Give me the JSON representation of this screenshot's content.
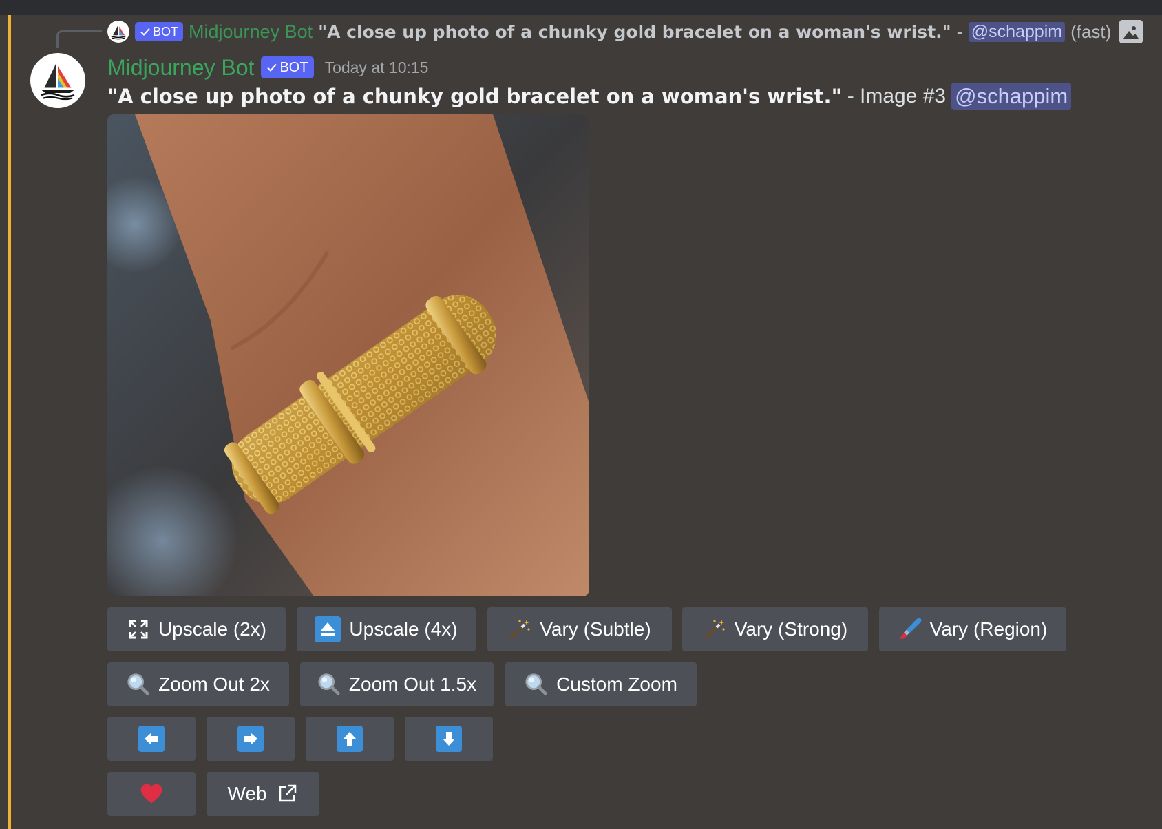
{
  "reply": {
    "bot_tag": "BOT",
    "author": "Midjourney Bot",
    "prompt": "\"A close up photo of a chunky gold bracelet on a woman's wrist.\"",
    "separator": "-",
    "mention": "@schappim",
    "mode": "(fast)"
  },
  "message": {
    "author": "Midjourney Bot",
    "bot_tag": "BOT",
    "timestamp": "Today at 10:15",
    "prompt": "\"A close up photo of a chunky gold bracelet on a woman's wrist.\"",
    "image_label": "- Image #3",
    "mention": "@schappim"
  },
  "buttons": {
    "upscale_2x": "Upscale (2x)",
    "upscale_4x": "Upscale (4x)",
    "vary_subtle": "Vary (Subtle)",
    "vary_strong": "Vary (Strong)",
    "vary_region": "Vary (Region)",
    "zoom_out_2x": "Zoom Out 2x",
    "zoom_out_1_5x": "Zoom Out 1.5x",
    "custom_zoom": "Custom Zoom",
    "web": "Web"
  },
  "icons": {
    "upscale_2x": "expand-icon",
    "upscale_4x": "up-arrow-box-icon",
    "vary_subtle": "magic-wand-icon",
    "vary_strong": "magic-wand-icon",
    "vary_region": "paintbrush-icon",
    "zoom": "magnifier-icon",
    "pan_left": "arrow-left-icon",
    "pan_right": "arrow-right-icon",
    "pan_up": "arrow-up-icon",
    "pan_down": "arrow-down-icon",
    "favorite": "heart-icon",
    "web": "external-link-icon"
  },
  "colors": {
    "background": "#3f3c3a",
    "highlight_bar": "#f0b232",
    "author": "#3ba55c",
    "bot_tag": "#5865f2",
    "mention_bg": "#4e5387",
    "button": "#4e5058",
    "arrow_blue": "#3c8fd7",
    "heart": "#dd2e44"
  }
}
